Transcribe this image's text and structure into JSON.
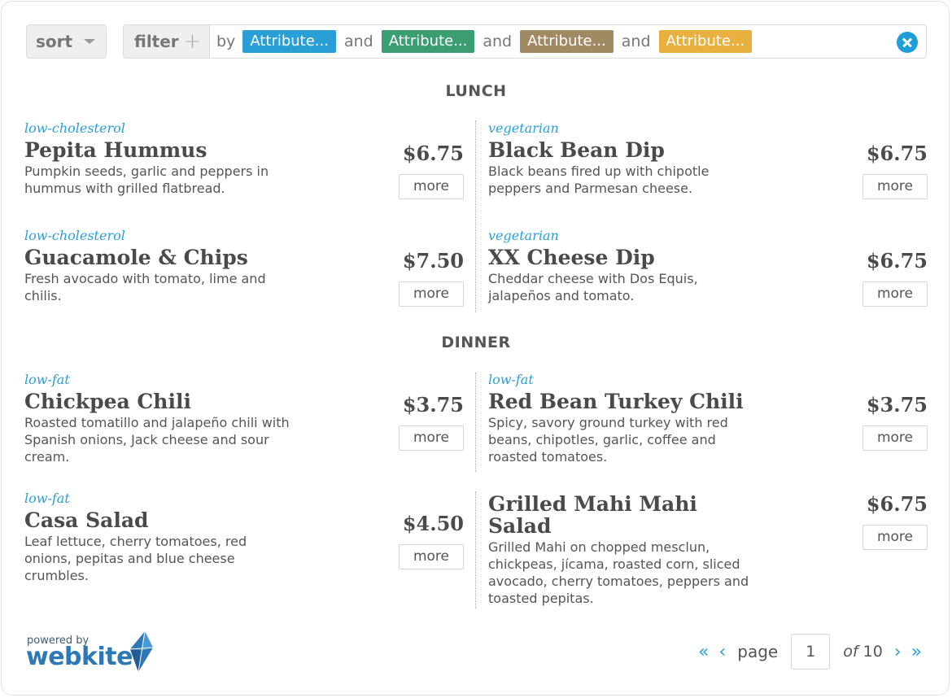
{
  "toolbar": {
    "sort_label": "sort",
    "filter_label": "filter",
    "filter_plus": "+",
    "by_label": "by",
    "chips": [
      {
        "label": "Attribute...",
        "color": "#2a9fd6"
      },
      {
        "label": "Attribute...",
        "color": "#3a9e72"
      },
      {
        "label": "Attribute...",
        "color": "#a08a64"
      },
      {
        "label": "Attribute...",
        "color": "#e8b03e"
      }
    ],
    "conjunction": "and"
  },
  "sections": [
    {
      "title": "LUNCH",
      "items": [
        {
          "tag": "low-cholesterol",
          "name": "Pepita Hummus",
          "desc": "Pumpkin seeds, garlic and peppers in hummus with grilled flatbread.",
          "price": "$6.75",
          "more": "more"
        },
        {
          "tag": "vegetarian",
          "name": "Black Bean Dip",
          "desc": "Black beans fired up with chipotle peppers and Parmesan cheese.",
          "price": "$6.75",
          "more": "more"
        },
        {
          "tag": "low-cholesterol",
          "name": "Guacamole & Chips",
          "desc": "Fresh avocado with tomato, lime and chilis.",
          "price": "$7.50",
          "more": "more"
        },
        {
          "tag": "vegetarian",
          "name": "XX Cheese Dip",
          "desc": "Cheddar cheese with Dos Equis, jalapeños and tomato.",
          "price": "$6.75",
          "more": "more"
        }
      ]
    },
    {
      "title": "DINNER",
      "items": [
        {
          "tag": "low-fat",
          "name": "Chickpea Chili",
          "desc": "Roasted tomatillo and jalapeño chili with Spanish onions, Jack cheese and sour cream.",
          "price": "$3.75",
          "more": "more"
        },
        {
          "tag": "low-fat",
          "name": "Red Bean Turkey Chili",
          "desc": "Spicy, savory ground turkey with red beans, chipotles, garlic, coffee and roasted tomatoes.",
          "price": "$3.75",
          "more": "more"
        },
        {
          "tag": "low-fat",
          "name": "Casa Salad",
          "desc": "Leaf lettuce, cherry tomatoes, red onions, pepitas and blue cheese crumbles.",
          "price": "$4.50",
          "more": "more"
        },
        {
          "tag": "",
          "name": "Grilled Mahi Mahi Salad",
          "desc": "Grilled Mahi on chopped mesclun, chickpeas, jícama, roasted corn, sliced avocado, cherry tomatoes, peppers and toasted pepitas.",
          "price": "$6.75",
          "more": "more"
        }
      ]
    }
  ],
  "footer": {
    "powered_by": "powered by",
    "brand": "webkite",
    "pager": {
      "first": "«",
      "prev": "‹",
      "page_label": "page",
      "current_page": "1",
      "of_label": "of",
      "total_pages": "10",
      "next": "›",
      "last": "»"
    }
  },
  "icons": {
    "sort_caret": "caret-down-icon",
    "clear": "close-circle-icon",
    "logo": "kite-logo-icon"
  }
}
